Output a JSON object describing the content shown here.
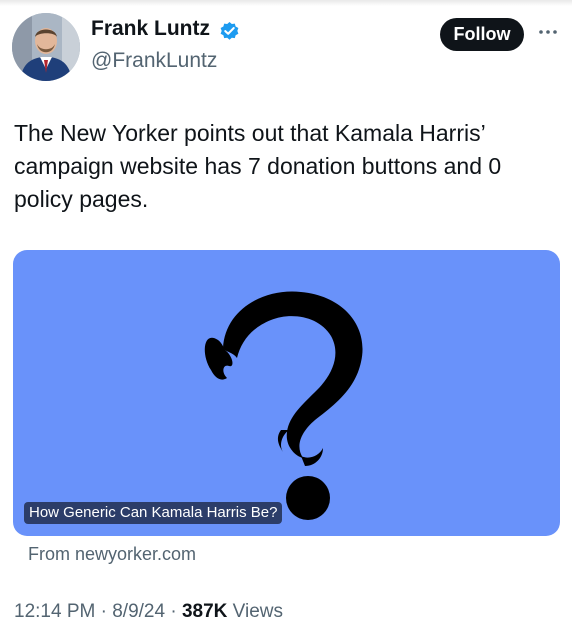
{
  "author": {
    "display_name": "Frank Luntz",
    "handle": "@FrankLuntz",
    "verified": true
  },
  "follow_button": {
    "label": "Follow"
  },
  "tweet": {
    "text": "The New Yorker points out that Kamala Harris’ campaign website has 7 donation buttons and 0 policy pages."
  },
  "link_card": {
    "headline": "How Generic Can Kamala Harris Be?",
    "source": "From newyorker.com",
    "background_color": "#6992fa"
  },
  "meta": {
    "time": "12:14 PM",
    "separator": "·",
    "date": "8/9/24",
    "views_count": "387K",
    "views_label": "Views"
  },
  "icons": {
    "verified": "verified-badge-icon",
    "more": "more-options-icon"
  },
  "colors": {
    "text_primary": "#0f1419",
    "text_secondary": "#536471",
    "verified_blue": "#1d9bf0",
    "button_bg": "#0f1419"
  }
}
